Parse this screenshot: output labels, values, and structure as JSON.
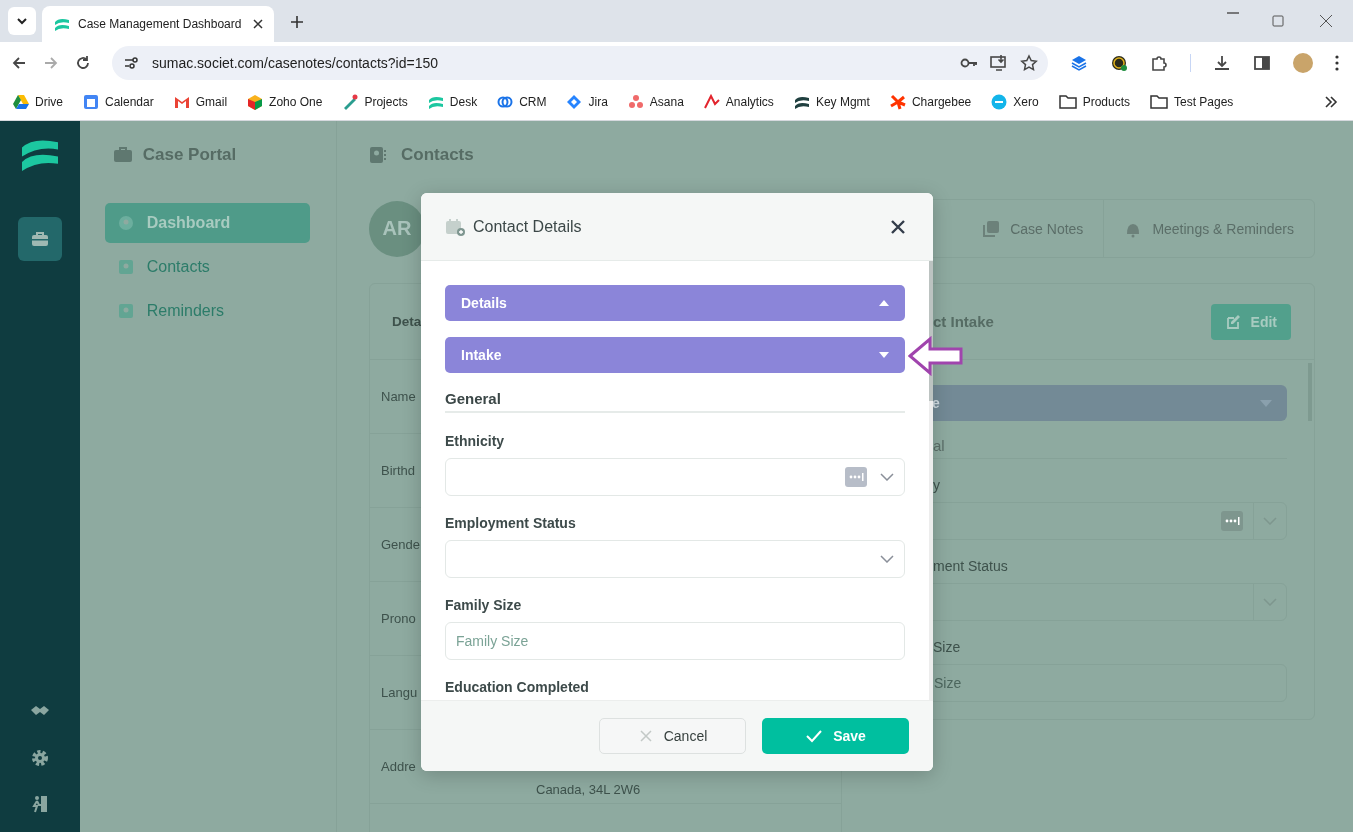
{
  "browser": {
    "tab_title": "Case Management Dashboard",
    "url": "sumac.societ.com/casenotes/contacts?id=150",
    "bookmarks": [
      {
        "label": "Drive",
        "kind": "site"
      },
      {
        "label": "Calendar",
        "kind": "site"
      },
      {
        "label": "Gmail",
        "kind": "site"
      },
      {
        "label": "Zoho One",
        "kind": "site"
      },
      {
        "label": "Projects",
        "kind": "site"
      },
      {
        "label": "Desk",
        "kind": "site"
      },
      {
        "label": "CRM",
        "kind": "site"
      },
      {
        "label": "Jira",
        "kind": "site"
      },
      {
        "label": "Asana",
        "kind": "site"
      },
      {
        "label": "Analytics",
        "kind": "site"
      },
      {
        "label": "Key Mgmt",
        "kind": "site"
      },
      {
        "label": "Chargebee",
        "kind": "site"
      },
      {
        "label": "Xero",
        "kind": "site"
      },
      {
        "label": "Products",
        "kind": "folder"
      },
      {
        "label": "Test Pages",
        "kind": "folder"
      }
    ]
  },
  "sidebar": {
    "title": "Case Portal",
    "items": [
      {
        "label": "Dashboard",
        "selected": true
      },
      {
        "label": "Contacts",
        "selected": false
      },
      {
        "label": "Reminders",
        "selected": false
      }
    ]
  },
  "main": {
    "title": "Contacts",
    "avatar": "AR",
    "tabs": [
      {
        "label": "Case Notes",
        "selected": false
      },
      {
        "label": "Meetings & Reminders",
        "selected": false
      }
    ],
    "details_card": {
      "title": "Deta",
      "rows": [
        {
          "label": "Name"
        },
        {
          "label": "Birthd"
        },
        {
          "label": "Gende"
        },
        {
          "label": "Prono"
        },
        {
          "label": "Langu"
        },
        {
          "label": "Addre",
          "value": "Canada, 34L 2W6"
        }
      ]
    },
    "intake_card": {
      "title": "ct Intake",
      "edit_button": "Edit",
      "items": [
        {
          "kind": "accordion",
          "label": "e",
          "expanded": false
        },
        {
          "kind": "heading",
          "text": "al"
        },
        {
          "kind": "label",
          "text": "y"
        },
        {
          "kind": "lookup"
        },
        {
          "kind": "label",
          "text": "ment Status"
        },
        {
          "kind": "select"
        },
        {
          "kind": "label",
          "text": "Size"
        },
        {
          "kind": "input",
          "placeholder": "Size"
        }
      ]
    }
  },
  "modal": {
    "title": "Contact Details",
    "sections": [
      {
        "label": "Details",
        "expanded": true
      },
      {
        "label": "Intake",
        "expanded": false
      }
    ],
    "group_title": "General",
    "fields": [
      {
        "label": "Ethnicity",
        "kind": "lookup"
      },
      {
        "label": "Employment Status",
        "kind": "select"
      },
      {
        "label": "Family Size",
        "kind": "input",
        "placeholder": "Family Size"
      },
      {
        "label": "Education Completed"
      }
    ],
    "cancel_button": "Cancel",
    "save_button": "Save"
  }
}
